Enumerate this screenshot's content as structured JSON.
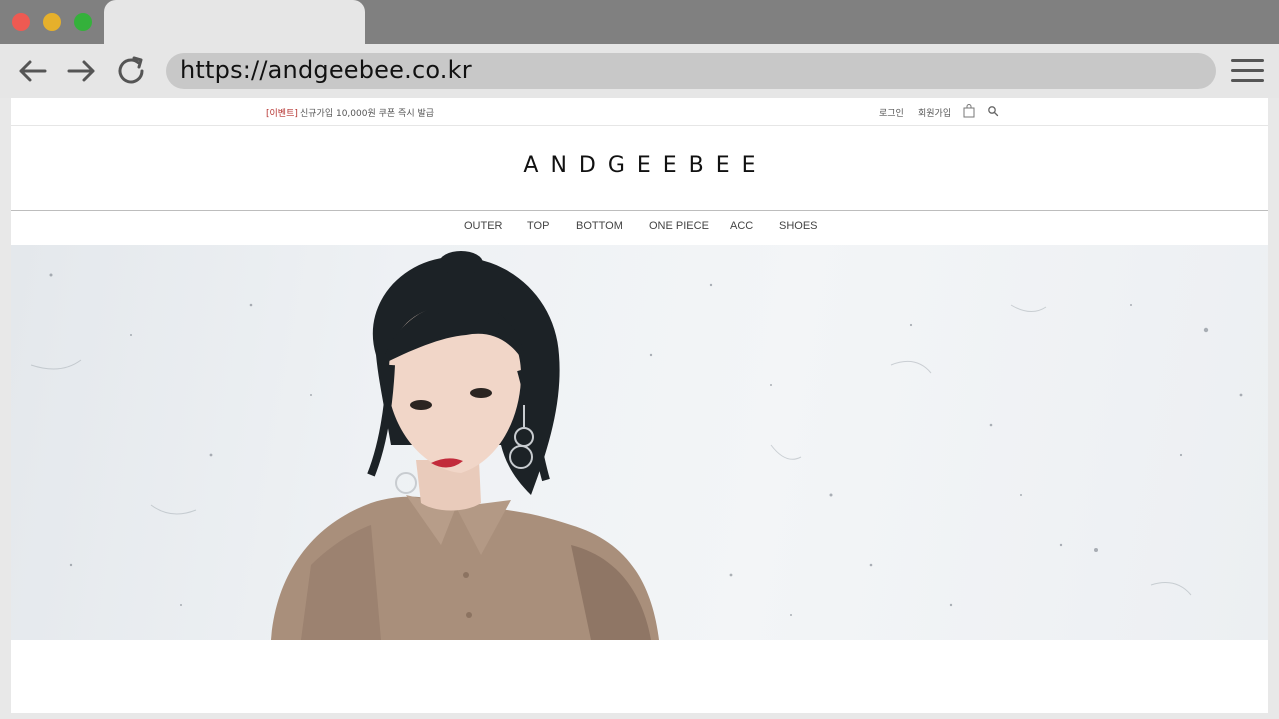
{
  "browser": {
    "url": "https://andgeebee.co.kr"
  },
  "site": {
    "event_tag": "[이벤트]",
    "event_text": "신규가입 10,000원 쿠폰 즉시 발급",
    "util": {
      "login": "로그인",
      "join": "회원가입"
    },
    "logo": "ANDGEEBEE",
    "nav": [
      "OUTER",
      "TOP",
      "BOTTOM",
      "ONE PIECE",
      "ACC",
      "SHOES"
    ]
  },
  "colors": {
    "event_red": "#b5322f",
    "chrome_dark": "#808080",
    "chrome_light": "#e6e6e6"
  },
  "icons": {
    "back": "back-arrow-icon",
    "forward": "forward-arrow-icon",
    "reload": "reload-icon",
    "menu": "hamburger-menu-icon",
    "bag": "shopping-bag-icon",
    "search": "search-icon"
  }
}
